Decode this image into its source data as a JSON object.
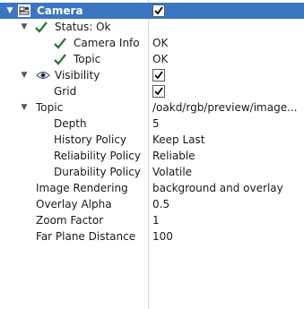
{
  "display": {
    "name": "Camera",
    "enabled": true,
    "icon": "camera-display-icon"
  },
  "status": {
    "label": "Status: Ok",
    "icon": "check-icon",
    "children": [
      {
        "label": "Camera Info",
        "value": "OK"
      },
      {
        "label": "Topic",
        "value": "OK"
      }
    ]
  },
  "visibility": {
    "label": "Visibility",
    "icon": "eye-icon",
    "checked": true,
    "grid": {
      "label": "Grid",
      "checked": true
    }
  },
  "topic": {
    "label": "Topic",
    "value": "/oakd/rgb/preview/image...",
    "children": [
      {
        "label": "Depth",
        "value": "5"
      },
      {
        "label": "History Policy",
        "value": "Keep Last"
      },
      {
        "label": "Reliability Policy",
        "value": "Reliable"
      },
      {
        "label": "Durability Policy",
        "value": "Volatile"
      }
    ]
  },
  "properties": [
    {
      "label": "Image Rendering",
      "value": "background and overlay"
    },
    {
      "label": "Overlay Alpha",
      "value": "0.5"
    },
    {
      "label": "Zoom Factor",
      "value": "1"
    },
    {
      "label": "Far Plane Distance",
      "value": "100"
    }
  ],
  "colors": {
    "selection": "#3b76c4",
    "check": "#2e7d32"
  }
}
